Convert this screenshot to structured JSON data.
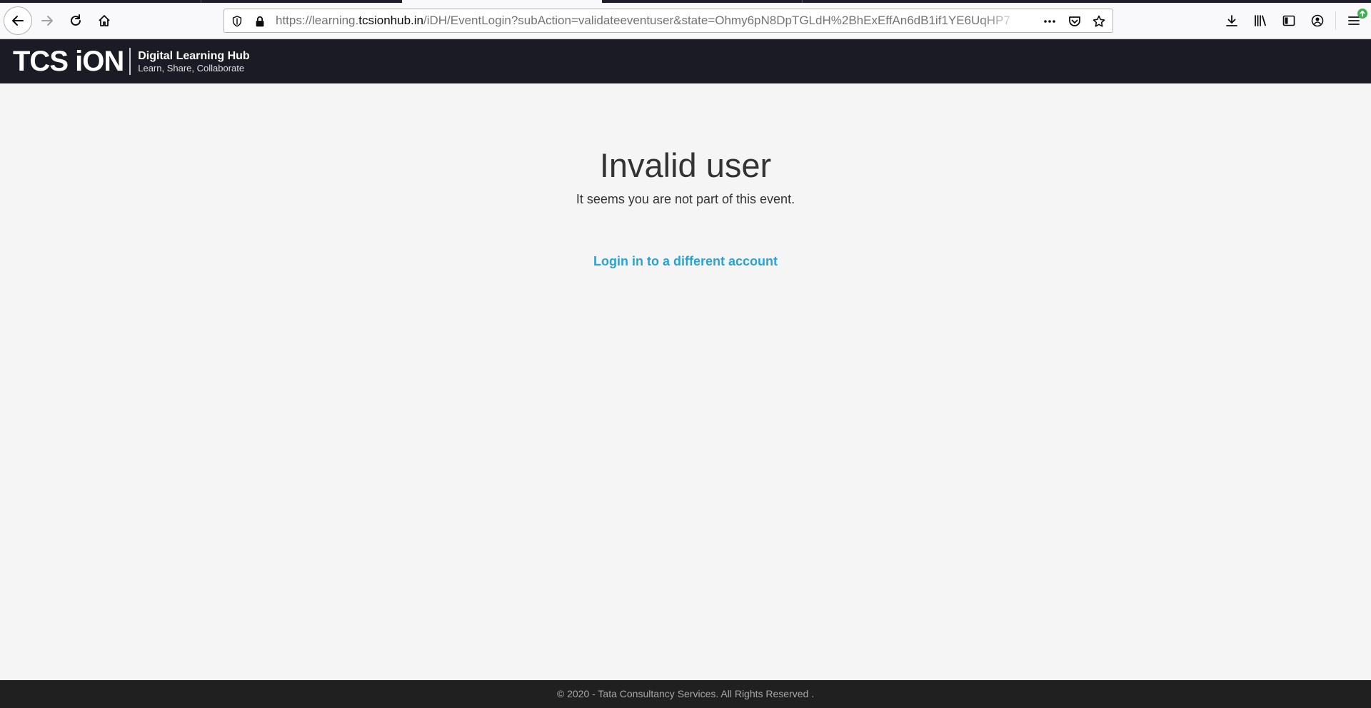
{
  "browser": {
    "url_prefix": "https://learning.",
    "url_host": "tcsionhub.in",
    "url_path": "/iDH/EventLogin?subAction=validateeventuser&state=Ohmy6pN8DpTGLdH%2BhExEffAn6dB1if1YE6UqHP7",
    "icons": [
      "back-icon",
      "forward-icon",
      "reload-icon",
      "home-icon",
      "shield-icon",
      "lock-icon",
      "more-icon",
      "pocket-icon",
      "star-icon",
      "download-icon",
      "library-icon",
      "sidebar-icon",
      "account-icon",
      "menu-icon"
    ],
    "badge_color": "#3fb24f"
  },
  "header": {
    "logo_mark": "TCS iON",
    "logo_title": "Digital Learning Hub",
    "logo_tagline": "Learn, Share, Collaborate"
  },
  "main": {
    "title": "Invalid user",
    "message": "It seems you are not part of this event.",
    "link_label": "Login in to a different account",
    "link_color": "#29a3d6"
  },
  "footer": {
    "text": "© 2020 - Tata Consultancy Services. All Rights Reserved ."
  }
}
